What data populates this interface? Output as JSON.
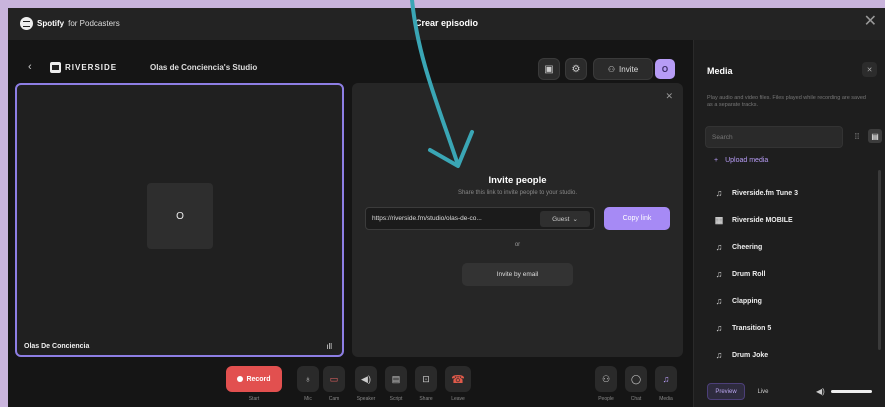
{
  "window": {
    "brand_bold": "Spotify",
    "brand_rest": "for Podcasters",
    "title": "Crear episodio",
    "close": "✕"
  },
  "studio": {
    "back": "‹",
    "logo_text": "RIVERSIDE",
    "name": "Olas de Conciencia's Studio",
    "invite_label": "Invite",
    "avatar_initial": "O"
  },
  "participant": {
    "initial": "O",
    "name": "Olas De Conciencia"
  },
  "invite": {
    "title": "Invite people",
    "subtitle": "Share this link to invite people to your studio.",
    "link": "https://riverside.fm/studio/olas-de-co...",
    "role": "Guest",
    "copy_label": "Copy link",
    "or": "or",
    "email_label": "Invite by email"
  },
  "controls": {
    "record_label": "Record",
    "record_sub": "Start",
    "items": [
      {
        "label": "Mic"
      },
      {
        "label": "Cam"
      },
      {
        "label": "Speaker"
      },
      {
        "label": "Script"
      },
      {
        "label": "Share"
      },
      {
        "label": "Leave"
      }
    ],
    "right": [
      {
        "label": "People"
      },
      {
        "label": "Chat"
      },
      {
        "label": "Media"
      }
    ]
  },
  "media": {
    "title": "Media",
    "description": "Play audio and video files. Files played while recording are saved as a separate tracks.",
    "search_placeholder": "Search",
    "upload_label": "Upload media",
    "items": [
      {
        "name": "Riverside.fm Tune 3",
        "icon": "music-note-icon"
      },
      {
        "name": "Riverside MOBILE",
        "icon": "video-file-icon"
      },
      {
        "name": "Cheering",
        "icon": "music-note-icon"
      },
      {
        "name": "Drum Roll",
        "icon": "music-note-icon"
      },
      {
        "name": "Clapping",
        "icon": "music-note-icon"
      },
      {
        "name": "Transition 5",
        "icon": "music-note-icon"
      },
      {
        "name": "Drum Joke",
        "icon": "music-note-icon"
      }
    ],
    "tab_preview": "Preview",
    "tab_live": "Live"
  }
}
